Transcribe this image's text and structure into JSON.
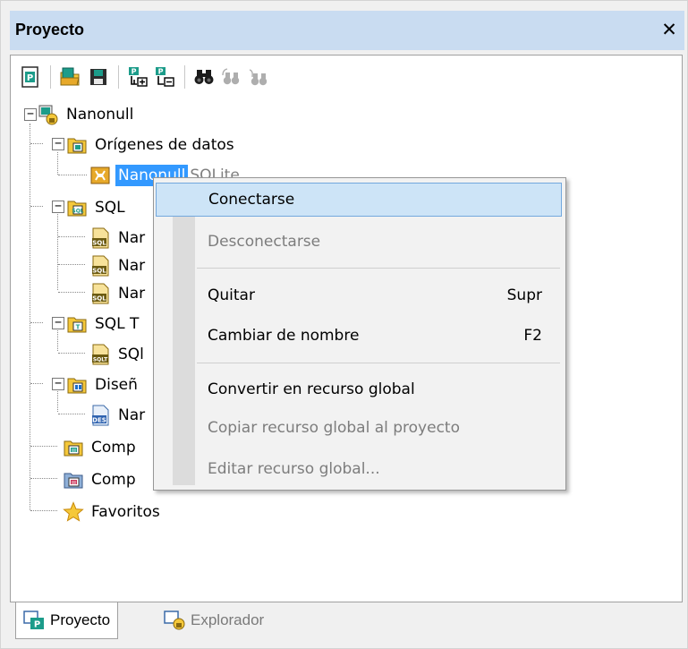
{
  "window": {
    "title": "Proyecto",
    "close_glyph": "✕"
  },
  "toolbar": {
    "buttons": [
      {
        "name": "new-project",
        "icon": "project-new-icon",
        "tooltip": ""
      },
      {
        "name": "open-project",
        "icon": "open-project-icon"
      },
      {
        "name": "save-project",
        "icon": "save-icon"
      },
      {
        "name": "add-to-project",
        "icon": "add-to-project-icon"
      },
      {
        "name": "remove-from-project",
        "icon": "remove-from-project-icon"
      },
      {
        "name": "find",
        "icon": "binoculars-icon"
      },
      {
        "name": "find-next",
        "icon": "find-next-icon"
      },
      {
        "name": "find-prev",
        "icon": "find-prev-icon"
      }
    ]
  },
  "tree": {
    "root": "Nanonull",
    "data_sources_folder": "Orígenes de datos",
    "data_source_name": "Nanonull",
    "data_source_type": "SQLite",
    "sql_folder": "SQL",
    "sql_item_1": "Nar",
    "sql_item_2": "Nar",
    "sql_item_3": "Nar",
    "sqlt_folder": "SQL T",
    "sqlt_item": "SQl",
    "design_folder": "Diseñ",
    "design_item": "Nar",
    "compare_1": "Comp",
    "compare_2": "Comp",
    "favorites": "Favoritos"
  },
  "tabs": {
    "project": "Proyecto",
    "explorer": "Explorador"
  },
  "context_menu": {
    "connect": "Conectarse",
    "disconnect": "Desconectarse",
    "remove": "Quitar",
    "remove_key": "Supr",
    "rename": "Cambiar de nombre",
    "rename_key": "F2",
    "convert_global": "Convertir en recurso global",
    "copy_global": "Copiar recurso global al proyecto",
    "edit_global": "Editar recurso global..."
  },
  "colors": {
    "title_bar": "#c9dcf1",
    "selection": "#3399ff",
    "menu_highlight": "#cde4f7"
  }
}
